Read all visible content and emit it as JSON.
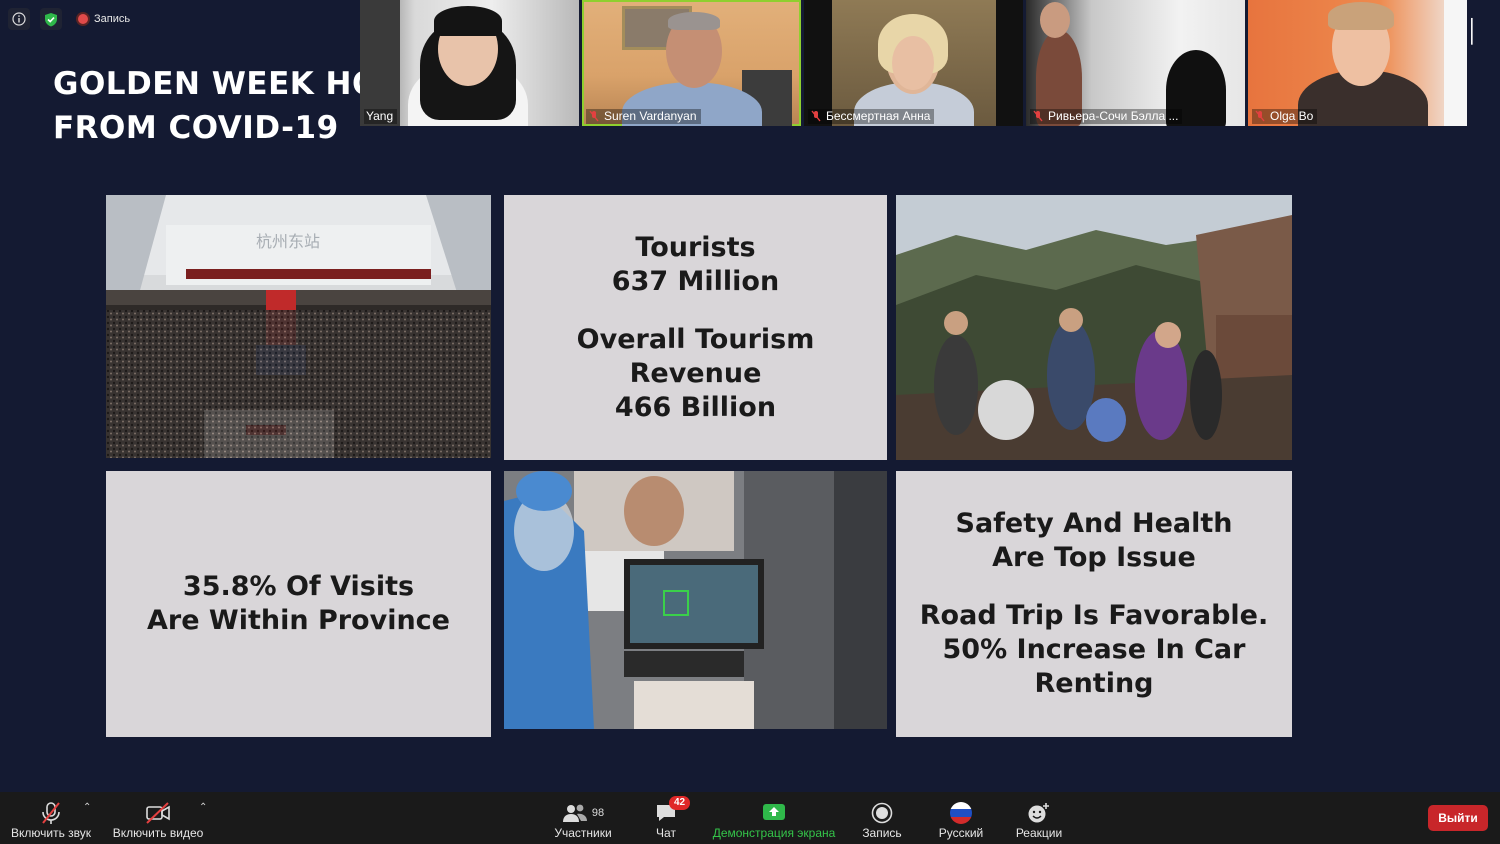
{
  "top_status": {
    "record_label": "Запись"
  },
  "slide": {
    "title_line1": "GOLDEN WEEK HO",
    "title_line2": "FROM COVID-19",
    "cell_tourists": {
      "line1": "Tourists",
      "line2": "637 Million",
      "line3": "Overall Tourism",
      "line4": "Revenue",
      "line5": "466 Billion"
    },
    "cell_visits": {
      "line1": "35.8% Of Visits",
      "line2": "Are Within Province"
    },
    "cell_safety": {
      "line1": "Safety And Health",
      "line2": "Are Top Issue",
      "line3": "Road Trip Is Favorable.",
      "line4": "50% Increase In Car Renting"
    },
    "photo_station_sign": "杭州东站"
  },
  "participants": [
    {
      "name": "Yang",
      "muted": false
    },
    {
      "name": "Suren Vardanyan",
      "muted": true,
      "active": true
    },
    {
      "name": "Бессмертная Анна",
      "muted": true
    },
    {
      "name": "Ривьера-Сочи Бэлла ...",
      "muted": true
    },
    {
      "name": "Olga Bo",
      "muted": true
    }
  ],
  "toolbar": {
    "unmute_label": "Включить звук",
    "video_label": "Включить видео",
    "participants_label": "Участники",
    "participants_count": "98",
    "chat_label": "Чат",
    "chat_badge": "42",
    "share_label": "Демонстрация экрана",
    "record_label": "Запись",
    "language_label": "Русский",
    "reactions_label": "Реакции",
    "leave_label": "Выйти"
  },
  "colors": {
    "background": "#141a32",
    "text_cell": "#d9d6d9",
    "share_green": "#34c449",
    "leave_red": "#c8262a",
    "active_speaker": "#8fcf2f"
  }
}
